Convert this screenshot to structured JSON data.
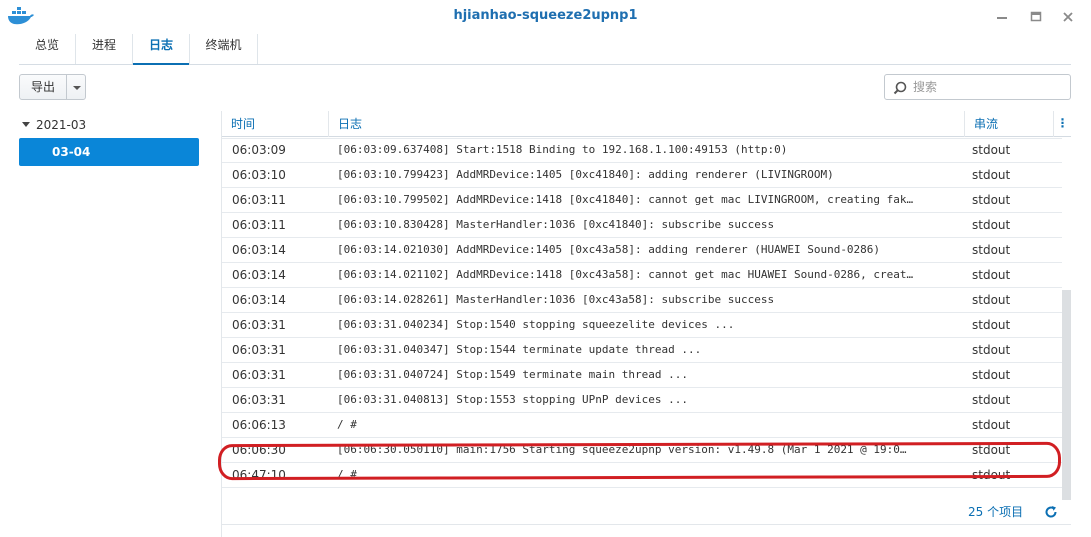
{
  "window": {
    "title": "hjianhao-squeeze2upnp1",
    "icon": "docker-whale-icon"
  },
  "tabs": [
    {
      "label": "总览"
    },
    {
      "label": "进程"
    },
    {
      "label": "日志",
      "active": true
    },
    {
      "label": "终端机"
    }
  ],
  "toolbar": {
    "export_label": "导出",
    "search_placeholder": "搜索"
  },
  "sidebar": {
    "month": "2021-03",
    "selected_day": "03-04"
  },
  "table": {
    "columns": {
      "time": "时间",
      "log": "日志",
      "stream": "串流"
    },
    "rows": [
      {
        "time": "06:03:09",
        "log": "[06:03:09.637408] Start:1518 Binding to 192.168.1.100:49153 (http:0)",
        "stream": "stdout"
      },
      {
        "time": "06:03:10",
        "log": "[06:03:10.799423] AddMRDevice:1405 [0xc41840]: adding renderer (LIVINGROOM)",
        "stream": "stdout"
      },
      {
        "time": "06:03:11",
        "log": "[06:03:10.799502] AddMRDevice:1418 [0xc41840]: cannot get mac LIVINGROOM, creating fak…",
        "stream": "stdout"
      },
      {
        "time": "06:03:11",
        "log": "[06:03:10.830428] MasterHandler:1036 [0xc41840]: subscribe success",
        "stream": "stdout"
      },
      {
        "time": "06:03:14",
        "log": "[06:03:14.021030] AddMRDevice:1405 [0xc43a58]: adding renderer (HUAWEI Sound-0286)",
        "stream": "stdout"
      },
      {
        "time": "06:03:14",
        "log": "[06:03:14.021102] AddMRDevice:1418 [0xc43a58]: cannot get mac HUAWEI Sound-0286, creat…",
        "stream": "stdout"
      },
      {
        "time": "06:03:14",
        "log": "[06:03:14.028261] MasterHandler:1036 [0xc43a58]: subscribe success",
        "stream": "stdout"
      },
      {
        "time": "06:03:31",
        "log": "[06:03:31.040234] Stop:1540 stopping squeezelite devices ...",
        "stream": "stdout"
      },
      {
        "time": "06:03:31",
        "log": "[06:03:31.040347] Stop:1544 terminate update thread ...",
        "stream": "stdout"
      },
      {
        "time": "06:03:31",
        "log": "[06:03:31.040724] Stop:1549 terminate main thread ...",
        "stream": "stdout"
      },
      {
        "time": "06:03:31",
        "log": "[06:03:31.040813] Stop:1553 stopping UPnP devices ...",
        "stream": "stdout"
      },
      {
        "time": "06:06:13",
        "log": "/ #",
        "stream": "stdout"
      },
      {
        "time": "06:06:30",
        "log": "[06:06:30.050110] main:1756 Starting squeeze2upnp version: v1.49.8 (Mar  1 2021 @ 19:0…",
        "stream": "stdout",
        "highlighted": true
      },
      {
        "time": "06:47:10",
        "log": "/ #",
        "stream": "stdout"
      }
    ]
  },
  "footer": {
    "count": "25 个项目"
  },
  "colors": {
    "accent": "#0b6fb3",
    "selected": "#0a86d8",
    "highlight": "#d11f23"
  }
}
